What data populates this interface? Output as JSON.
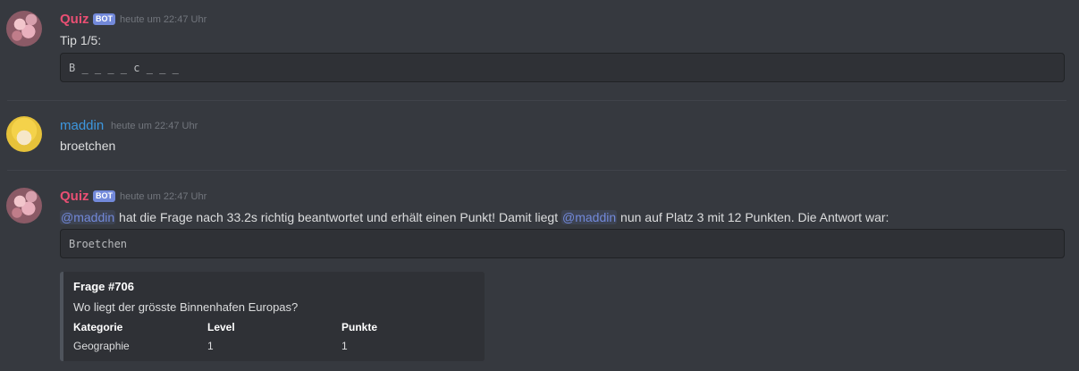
{
  "messages": [
    {
      "author": "Quiz",
      "bot_tag": "BOT",
      "timestamp": "heute um 22:47 Uhr",
      "text": "Tip 1/5:",
      "code": "B _ _ _ _ c _ _ _"
    },
    {
      "author": "maddin",
      "timestamp": "heute um 22:47 Uhr",
      "text": "broetchen"
    },
    {
      "author": "Quiz",
      "bot_tag": "BOT",
      "timestamp": "heute um 22:47 Uhr",
      "mention1": "@maddin",
      "text_part1": " hat die Frage nach 33.2s richtig beantwortet und erhält einen Punkt! Damit liegt ",
      "mention2": "@maddin",
      "text_part2": " nun auf Platz 3 mit 12 Punkten. Die Antwort war:",
      "code": "Broetchen",
      "embed": {
        "title": "Frage #706",
        "description": "Wo liegt der grösste Binnenhafen Europas?",
        "fields": [
          {
            "name": "Kategorie",
            "value": "Geographie"
          },
          {
            "name": "Level",
            "value": "1"
          },
          {
            "name": "Punkte",
            "value": "1"
          }
        ]
      }
    }
  ],
  "colors": {
    "background": "#36393f",
    "bot_name": "#e94f73",
    "user_name": "#3d97df",
    "bot_tag": "#7289da",
    "mention": "#7289da"
  }
}
